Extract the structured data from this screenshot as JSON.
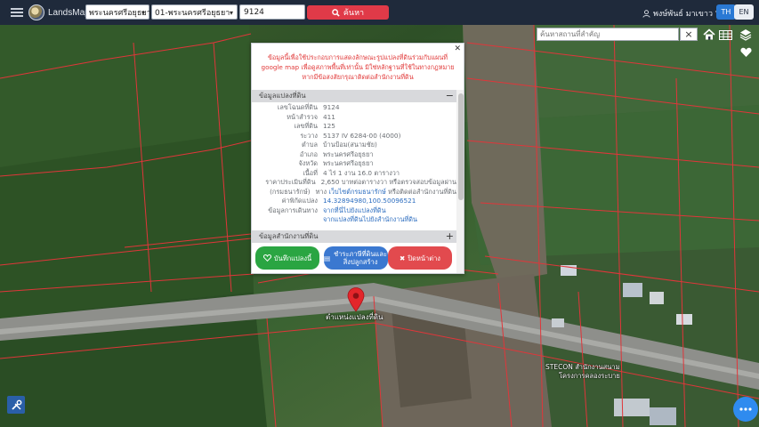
{
  "header": {
    "brand": "LandsMaps",
    "province_select": "พระนครศรีอยุธยา",
    "amphoe_select": "01-พระนครศรีอยุธยา",
    "parcel_input": "9124",
    "search_label": "ค้นหา",
    "user_name": "พงษ์พันธ์ มาเขาว",
    "lang_th": "TH",
    "lang_en": "EN"
  },
  "map_tools": {
    "place_search_placeholder": "ค้นหาสถานที่สำคัญ",
    "clear": "×"
  },
  "popup": {
    "notice": "ข้อมูลนี้เพื่อใช้ประกอบการแสดงลักษณะรูปแปลงที่ดินร่วมกับแผนที่ google map เพื่อดูสภาพพื้นที่เท่านั้น มิใช่หลักฐานที่ใช้ในทางกฎหมาย หากมีข้อสงสัยกรุณาติดต่อสำนักงานที่ดิน",
    "section_parcel": "ข้อมูลแปลงที่ดิน",
    "section_office": "ข้อมูลสำนักงานที่ดิน",
    "rows": [
      {
        "k": "เลขโฉนดที่ดิน",
        "v": "9124"
      },
      {
        "k": "หน้าสำรวจ",
        "v": "411"
      },
      {
        "k": "เลขที่ดิน",
        "v": "125"
      },
      {
        "k": "ระวาง",
        "v": "5137 IV 6284-00 (4000)"
      },
      {
        "k": "ตำบล",
        "v": "บ้านป้อม(สนามชัย)"
      },
      {
        "k": "อำเภอ",
        "v": "พระนครศรีอยุธยา"
      },
      {
        "k": "จังหวัด",
        "v": "พระนครศรีอยุธยา"
      },
      {
        "k": "เนื้อที่",
        "v": "4 ไร่ 1 งาน 16.0 ตารางวา"
      },
      {
        "k": "ราคาประเมินที่ดิน",
        "v": "2,650 บาทต่อตารางวา หรือตรวจสอบข้อมูลผ่าน"
      },
      {
        "k": "(กรมธนารักษ์)",
        "v_pre": "ทาง ",
        "v_link": "เว็บไซต์กรมธนารักษ์",
        "v_post": " หรือติดต่อสำนักงานที่ดิน"
      },
      {
        "k": "ค่าพิกัดแปลง",
        "v_link": "14.32894980,100.50096521"
      },
      {
        "k": "ข้อมูลการเดินทาง",
        "v_link": "จากที่นี่ไปยังแปลงที่ดิน"
      },
      {
        "k": "",
        "v_link": "จากแปลงที่ดินไปยังสำนักงานที่ดิน"
      }
    ],
    "btn_save": "บันทึกแปลงนี้",
    "btn_tax": "ชำระภาษีที่ดินและสิ่งปลูกสร้าง",
    "btn_close": "ปิดหน้าต่าง"
  },
  "marker": {
    "label": "ตำแหน่งแปลงที่ดิน"
  },
  "map_labels": {
    "stecon": "STECON สำนักงานสนาม",
    "stecon_sub": "โครงการคลองระบาย"
  },
  "colors": {
    "topbar": "#1f2a3b",
    "search_button": "#e03a48",
    "lang_active": "#2a79d4",
    "parcel_lines": "#e0363a",
    "btn_green": "#2aa542",
    "btn_blue": "#3a78d0",
    "btn_red": "#e24a4e",
    "marker": "#e3262b"
  }
}
